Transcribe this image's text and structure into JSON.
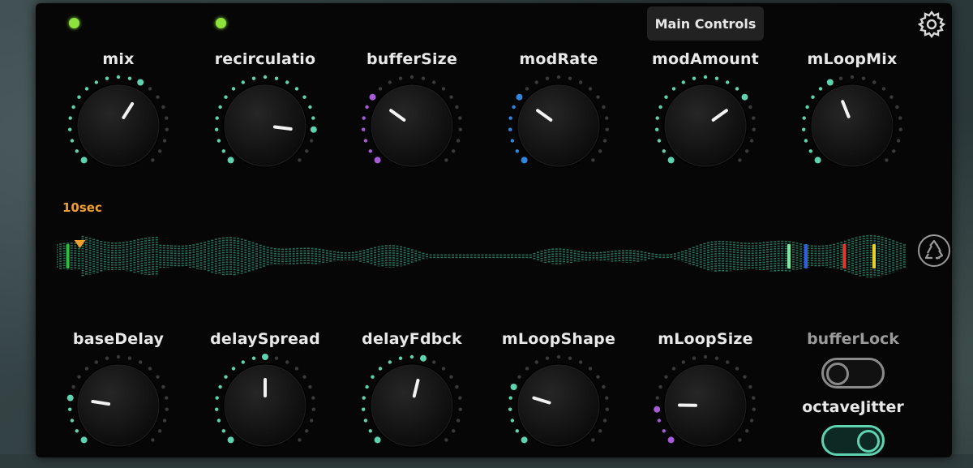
{
  "tooltip": "Main Controls",
  "icons": {
    "settings": "gear-icon",
    "refresh": "recycle-icon"
  },
  "colors": {
    "teal": "#5fd3b0",
    "purple": "#a45bd6",
    "blue": "#2f86e0",
    "led": "#8ee23c",
    "orange": "#f0a030",
    "wave": "#2f7f67"
  },
  "indicators": [
    {
      "name": "led-1",
      "on": true
    },
    {
      "name": "led-2",
      "on": true
    }
  ],
  "knobs_top": [
    {
      "label": "mix",
      "value": 0.62,
      "color": "teal"
    },
    {
      "label": "recirculatio",
      "value": 0.86,
      "color": "teal"
    },
    {
      "label": "bufferSize",
      "value": 0.3,
      "color": "purple"
    },
    {
      "label": "modRate",
      "value": 0.3,
      "color": "blue"
    },
    {
      "label": "modAmount",
      "value": 0.7,
      "color": "teal"
    },
    {
      "label": "mLoopMix",
      "value": 0.42,
      "color": "teal"
    }
  ],
  "knobs_bottom": [
    {
      "label": "baseDelay",
      "value": 0.2,
      "color": "teal"
    },
    {
      "label": "delaySpread",
      "value": 0.5,
      "color": "teal"
    },
    {
      "label": "delayFdbck",
      "value": 0.55,
      "color": "teal"
    },
    {
      "label": "mLoopShape",
      "value": 0.23,
      "color": "teal"
    },
    {
      "label": "mLoopSize",
      "value": 0.17,
      "color": "purple"
    }
  ],
  "buffer": {
    "time_label": "10sec",
    "playhead_position": 0.01,
    "markers": [
      {
        "position": 0.013,
        "color": "#2fbf3a"
      },
      {
        "position": 0.86,
        "color": "#7de8a0"
      },
      {
        "position": 0.88,
        "color": "#2f5fe0"
      },
      {
        "position": 0.925,
        "color": "#e03a2a"
      },
      {
        "position": 0.96,
        "color": "#e8d02a"
      }
    ]
  },
  "toggles": [
    {
      "label": "bufferLock",
      "on": false
    },
    {
      "label": "octaveJitter",
      "on": true
    }
  ]
}
